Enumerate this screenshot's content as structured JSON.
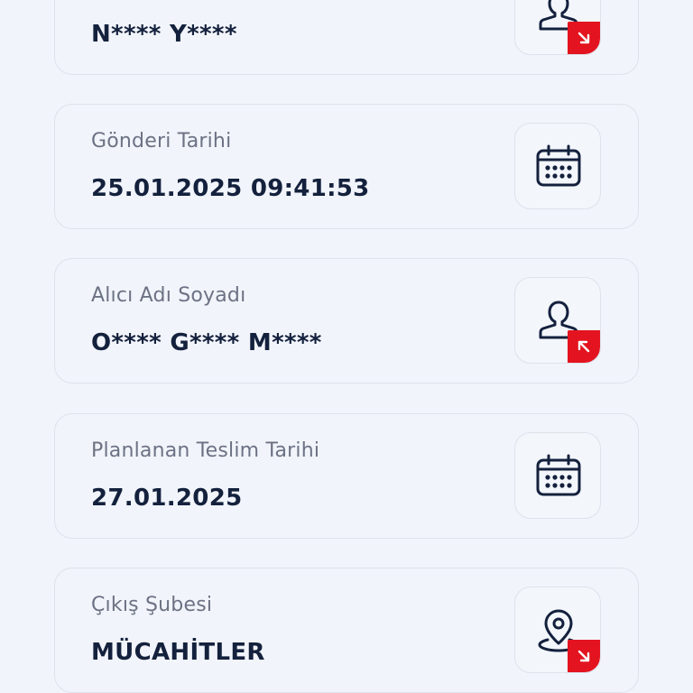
{
  "cards": [
    {
      "label": "",
      "value": "N**** Y****",
      "icon": "person-icon",
      "badge": "arrow-down-right-icon"
    },
    {
      "label": "Gönderi Tarihi",
      "value": "25.01.2025 09:41:53",
      "icon": "calendar-icon"
    },
    {
      "label": "Alıcı Adı Soyadı",
      "value": "O**** G**** M****",
      "icon": "person-icon",
      "badge": "arrow-up-left-icon"
    },
    {
      "label": "Planlanan Teslim Tarihi",
      "value": "27.01.2025",
      "icon": "calendar-icon"
    },
    {
      "label": "Çıkış Şubesi",
      "value": "MÜCAHİTLER",
      "icon": "location-pin-icon",
      "badge": "arrow-down-right-icon"
    }
  ],
  "colors": {
    "background": "#f1f4fa",
    "border": "#dde2ec",
    "label": "#6c7284",
    "value": "#14213d",
    "accent": "#e3141f",
    "icon": "#14213d"
  }
}
